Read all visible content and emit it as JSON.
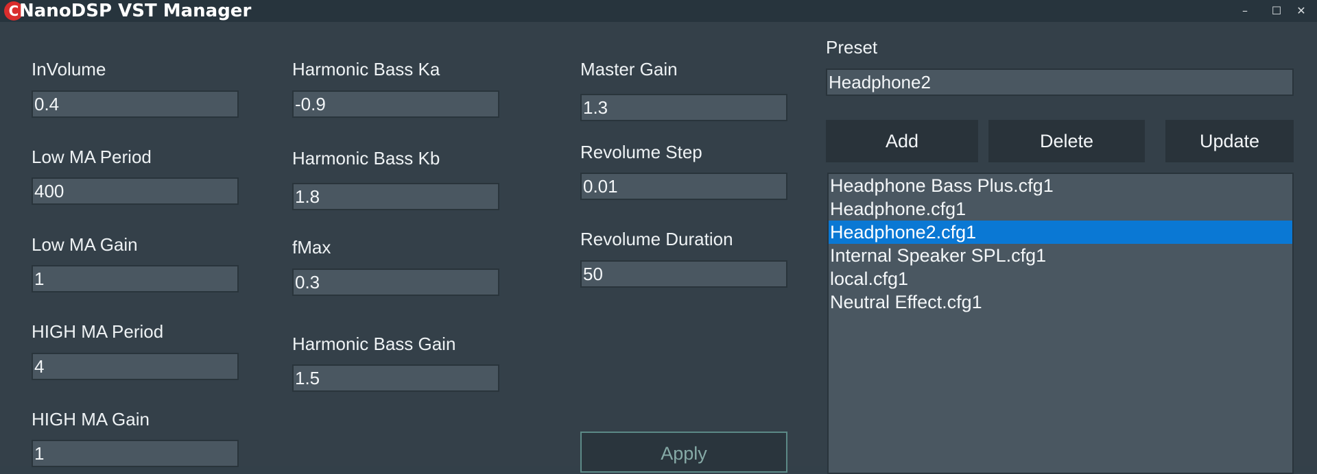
{
  "window": {
    "title": "NanoDSP VST Manager",
    "icon_letter": "C",
    "controls": [
      "minimize-icon",
      "maximize-icon",
      "close-icon"
    ],
    "minimize_glyph": "–",
    "maximize_glyph": "☐",
    "close_glyph": "✕"
  },
  "col1": {
    "in_volume": {
      "label": "InVolume",
      "value": "0.4"
    },
    "low_ma_period": {
      "label": "Low MA Period",
      "value": "400"
    },
    "low_ma_gain": {
      "label": "Low MA Gain",
      "value": "1"
    },
    "high_ma_period": {
      "label": "HIGH MA Period",
      "value": "4"
    },
    "high_ma_gain": {
      "label": "HIGH MA Gain",
      "value": "1"
    }
  },
  "col2": {
    "harmonic_bass_ka": {
      "label": "Harmonic Bass Ka",
      "value": "-0.9"
    },
    "harmonic_bass_kb": {
      "label": "Harmonic Bass Kb",
      "value": "1.8"
    },
    "fmax": {
      "label": "fMax",
      "value": "0.3"
    },
    "harmonic_bass_gain": {
      "label": "Harmonic Bass Gain",
      "value": "1.5"
    }
  },
  "col3": {
    "master_gain": {
      "label": "Master Gain",
      "value": "1.3"
    },
    "revolume_step": {
      "label": "Revolume Step",
      "value": "0.01"
    },
    "revolume_duration": {
      "label": "Revolume Duration",
      "value": "50"
    },
    "apply_label": "Apply"
  },
  "preset": {
    "label": "Preset",
    "value": "Headphone2",
    "add_label": "Add",
    "delete_label": "Delete",
    "update_label": "Update",
    "items": [
      "Headphone Bass Plus.cfg1",
      "Headphone.cfg1",
      "Headphone2.cfg1",
      "Internal Speaker SPL.cfg1",
      "local.cfg1",
      "Neutral Effect.cfg1"
    ],
    "selected_index": 2
  },
  "colors": {
    "background": "#344049",
    "field": "#4a5761",
    "button": "#29333a",
    "selection": "#0a78d4",
    "apply_border": "#5c8a87"
  }
}
